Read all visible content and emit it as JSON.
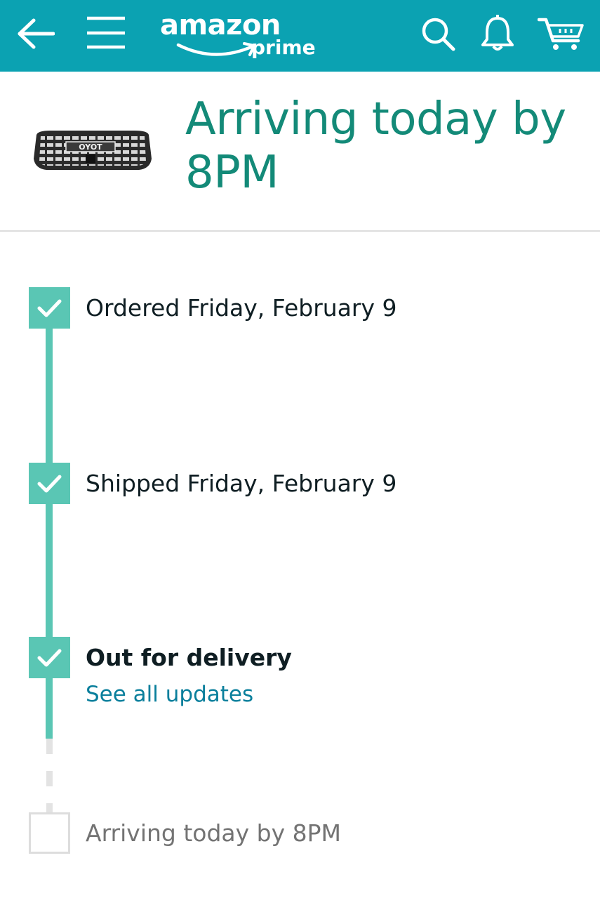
{
  "topbar": {
    "brand": "amazon",
    "brand_sub": "prime",
    "icons": [
      "back-arrow-icon",
      "hamburger-menu-icon",
      "search-icon",
      "bell-icon",
      "cart-icon"
    ],
    "color": "#0ba2b2"
  },
  "header": {
    "title": "Arriving today by 8PM",
    "product_image_text": "OYOT"
  },
  "timeline": {
    "steps": [
      {
        "label": "Ordered Friday, February 9",
        "status": "complete"
      },
      {
        "label": "Shipped Friday, February 9",
        "status": "complete"
      },
      {
        "label": "Out for delivery",
        "status": "complete",
        "link": "See all updates"
      },
      {
        "label": "Arriving today by 8PM",
        "status": "pending"
      }
    ],
    "accent_color": "#5ac6b4",
    "title_color": "#138a78",
    "link_color": "#0a7f9c"
  }
}
